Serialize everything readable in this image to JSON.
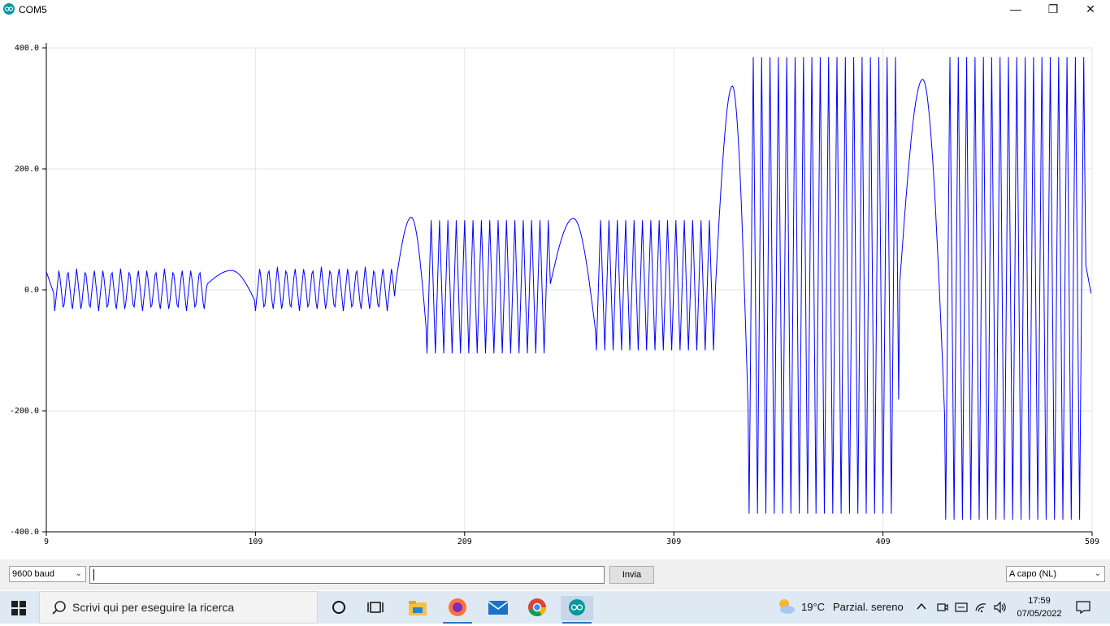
{
  "window": {
    "title": "COM5",
    "minimize_glyph": "—",
    "maximize_glyph": "❐",
    "close_glyph": "✕"
  },
  "plotter": {
    "y_ticks": [
      "400.0",
      "200.0",
      "0.0",
      "-200.0",
      "-400.0"
    ],
    "x_ticks": [
      "9",
      "109",
      "209",
      "309",
      "409",
      "509"
    ],
    "line_color": "#0000ff"
  },
  "chart_data": {
    "type": "line",
    "xlim": [
      9,
      509
    ],
    "ylim": [
      -400,
      400
    ],
    "grid": true,
    "series": [
      {
        "segments": [
          {
            "x0": 9,
            "x1": 13,
            "shape": "decay",
            "start": 30,
            "end": -10
          },
          {
            "x0": 13,
            "x1": 86,
            "shape": "osc",
            "period": 4.2,
            "low": -35,
            "high": 35
          },
          {
            "x0": 86,
            "x1": 109,
            "shape": "hump",
            "start": 10,
            "peak": 32,
            "end": -20
          },
          {
            "x0": 109,
            "x1": 176,
            "shape": "osc",
            "period": 4.2,
            "low": -35,
            "high": 38
          },
          {
            "x0": 176,
            "x1": 191,
            "shape": "hump",
            "start": 10,
            "peak": 120,
            "end": -80
          },
          {
            "x0": 191,
            "x1": 250,
            "shape": "osc",
            "period": 4,
            "low": -105,
            "high": 115
          },
          {
            "x0": 250,
            "x1": 272,
            "shape": "hump",
            "start": 10,
            "peak": 118,
            "end": -80
          },
          {
            "x0": 272,
            "x1": 329,
            "shape": "osc",
            "period": 4,
            "low": -100,
            "high": 115
          },
          {
            "x0": 329,
            "x1": 345,
            "shape": "hump",
            "start": 10,
            "peak": 337,
            "end": -250
          },
          {
            "x0": 345,
            "x1": 417,
            "shape": "osc",
            "period": 4,
            "low": -370,
            "high": 385
          },
          {
            "x0": 417,
            "x1": 439,
            "shape": "hump",
            "start": 10,
            "peak": 348,
            "end": -250
          },
          {
            "x0": 439,
            "x1": 506,
            "shape": "osc",
            "period": 4,
            "low": -380,
            "high": 385
          },
          {
            "x0": 506,
            "x1": 509,
            "shape": "decay",
            "start": 40,
            "end": -15
          }
        ]
      }
    ]
  },
  "controls": {
    "baud": "9600 baud",
    "send_input_value": "",
    "send_button": "Invia",
    "line_ending": "A capo (NL)"
  },
  "taskbar": {
    "search_placeholder": "Scrivi qui per eseguire la ricerca",
    "weather_temp": "19°C",
    "weather_text": "Parzial. sereno",
    "time": "17:59",
    "date": "07/05/2022"
  }
}
